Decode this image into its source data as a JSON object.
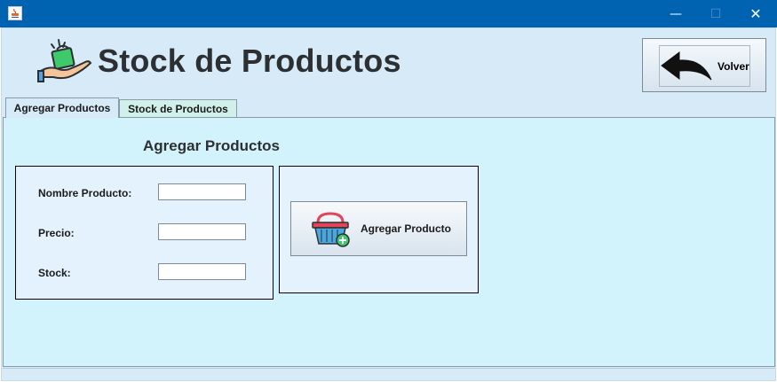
{
  "window": {
    "title": "",
    "controls": {
      "minimize": "—",
      "maximize": "☐",
      "close": "✕"
    }
  },
  "header": {
    "title": "Stock de Productos",
    "logo_icon": "hand-holding-shopping-bag-icon",
    "back_button_label": "Volver",
    "back_icon": "back-arrow-icon"
  },
  "tabs": [
    {
      "label": "Agregar Productos",
      "selected": true
    },
    {
      "label": "Stock de Productos",
      "selected": false
    }
  ],
  "form": {
    "section_title": "Agregar Productos",
    "fields": [
      {
        "label": "Nombre Producto:",
        "value": ""
      },
      {
        "label": "Precio:",
        "value": ""
      },
      {
        "label": "Stock:",
        "value": ""
      }
    ]
  },
  "actions": {
    "add_button_label": "Agregar Producto",
    "add_icon": "shopping-basket-add-icon"
  },
  "colors": {
    "titlebar": "#0063b1",
    "window_bg": "#d6eaf8",
    "panel_bg": "#d2f3fb",
    "selected_tab": "#d6eaf8",
    "unselected_tab": "#d2f0ea"
  }
}
